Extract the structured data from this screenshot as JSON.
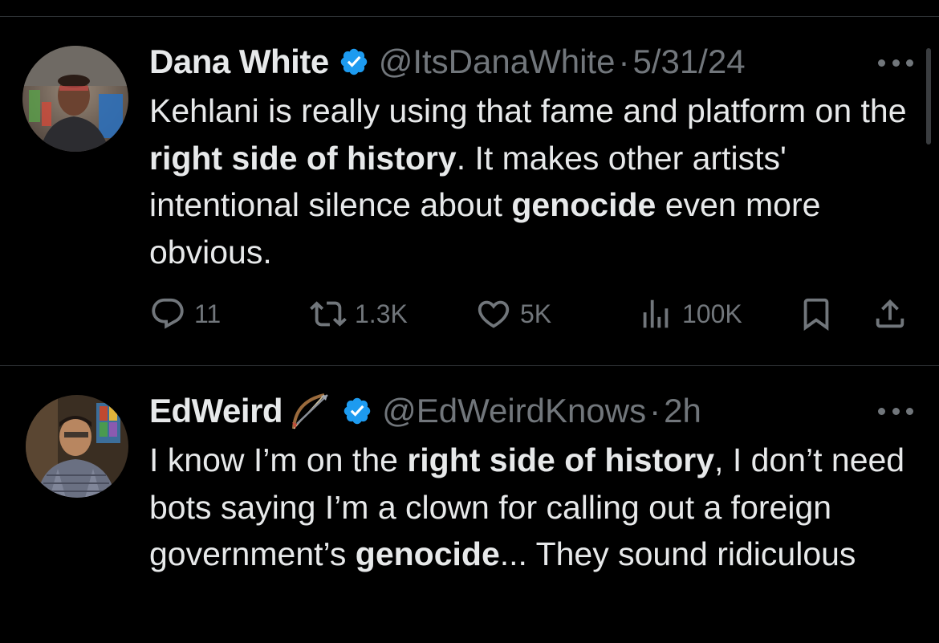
{
  "tweets": [
    {
      "author_name": "Dana White",
      "verified": true,
      "handle": "@ItsDanaWhite",
      "separator": "·",
      "timestamp": "5/31/24",
      "more_icon": "more-horizontal-icon",
      "body": {
        "p1": "Kehlani is really using that fame and platform on the ",
        "b1": "right side of history",
        "p2": ". It makes other artists' intentional silence about ",
        "b2": "genocide",
        "p3": " even more obvious."
      },
      "actions": {
        "replies": "11",
        "reposts": "1.3K",
        "likes": "5K",
        "views": "100K"
      }
    },
    {
      "author_name": "EdWeird",
      "name_emoji": "bow-and-arrow-icon",
      "verified": true,
      "handle": "@EdWeirdKnows",
      "separator": "·",
      "timestamp": "2h",
      "more_icon": "more-horizontal-icon",
      "body": {
        "p1": "I know I’m on the ",
        "b1": "right side of history",
        "p2": ", I don’t need bots saying I’m a clown for calling out a foreign government’s ",
        "b2": "genocide",
        "p3": "... They sound ridiculous"
      }
    }
  ],
  "colors": {
    "background": "#000000",
    "text_primary": "#e7e9ea",
    "text_secondary": "#71767b",
    "verified_blue": "#1d9bf0",
    "divider": "#2f3336"
  }
}
